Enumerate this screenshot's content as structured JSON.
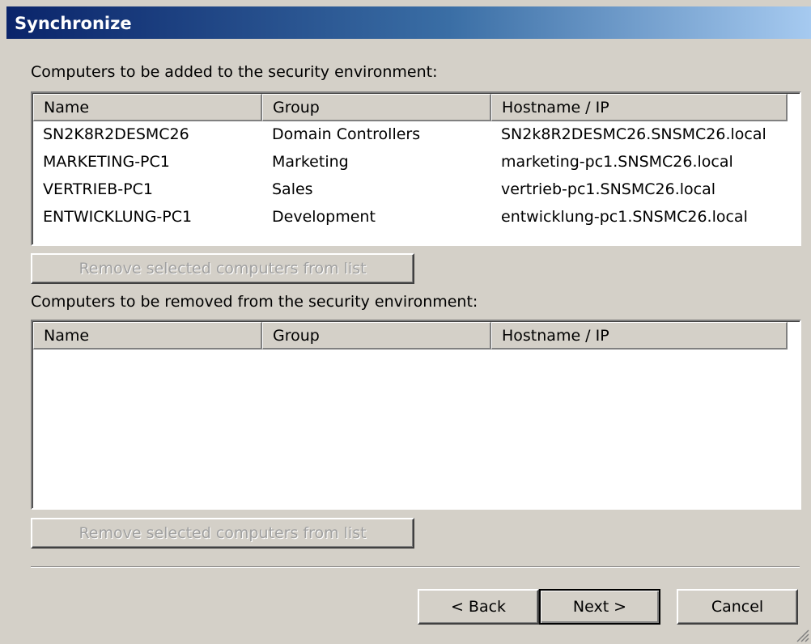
{
  "window": {
    "title": "Synchronize"
  },
  "add_section": {
    "label": "Computers to be added to the security environment:",
    "columns": [
      "Name",
      "Group",
      "Hostname / IP"
    ],
    "rows": [
      [
        "SN2K8R2DESMC26",
        "Domain Controllers",
        "SN2k8R2DESMC26.SNSMC26.local"
      ],
      [
        "MARKETING-PC1",
        "Marketing",
        "marketing-pc1.SNSMC26.local"
      ],
      [
        "VERTRIEB-PC1",
        "Sales",
        "vertrieb-pc1.SNSMC26.local"
      ],
      [
        "ENTWICKLUNG-PC1",
        "Development",
        "entwicklung-pc1.SNSMC26.local"
      ]
    ],
    "remove_button_label": "Remove selected computers from list"
  },
  "remove_section": {
    "label": "Computers to be removed from the security environment:",
    "columns": [
      "Name",
      "Group",
      "Hostname / IP"
    ],
    "rows": [],
    "remove_button_label": "Remove selected computers from list"
  },
  "footer": {
    "back_label": "< Back",
    "next_label": "Next >",
    "cancel_label": "Cancel"
  },
  "colors": {
    "face": "#d4d0c8",
    "title_start": "#0a246a",
    "title_end": "#a6caf0",
    "disabled_text": "#a0a0a0"
  }
}
